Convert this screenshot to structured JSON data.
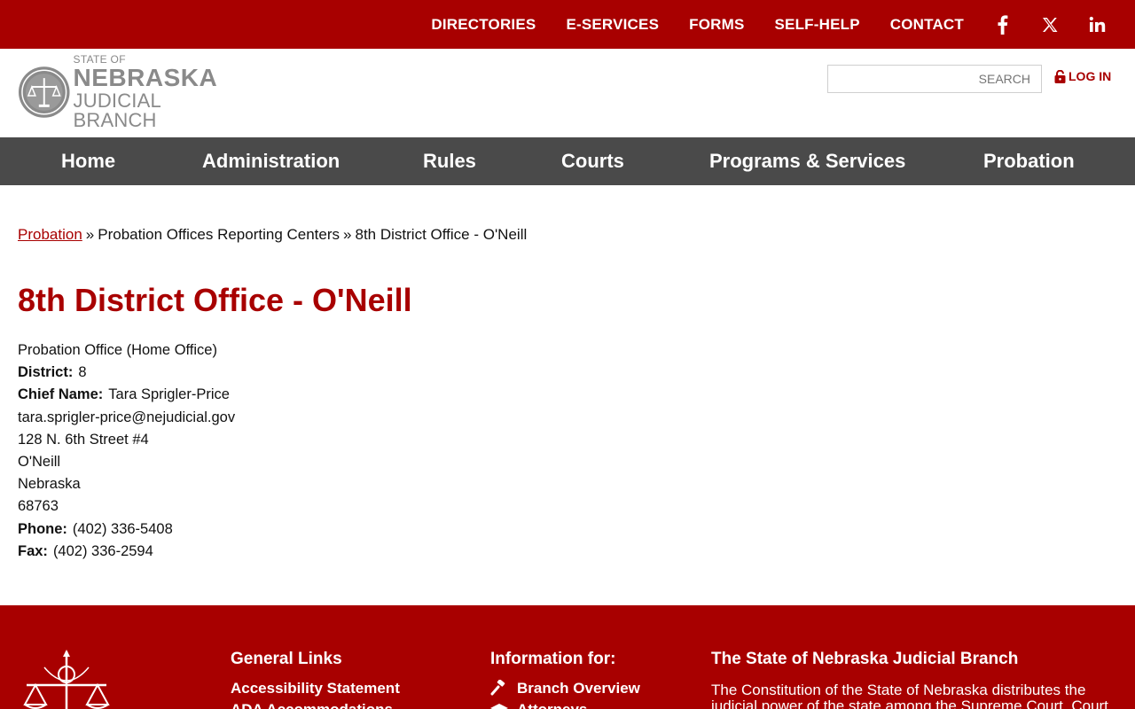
{
  "top_nav": {
    "links": [
      "DIRECTORIES",
      "E-SERVICES",
      "FORMS",
      "SELF-HELP",
      "CONTACT"
    ],
    "social_icons": [
      "facebook-icon",
      "x-icon",
      "linkedin-icon"
    ]
  },
  "header": {
    "logo": {
      "line1": "STATE OF",
      "line2": "NEBRASKA",
      "line3": "JUDICIAL BRANCH"
    },
    "search_placeholder": "SEARCH",
    "login_label": "LOG IN"
  },
  "main_nav": [
    "Home",
    "Administration",
    "Rules",
    "Courts",
    "Programs & Services",
    "Probation"
  ],
  "breadcrumb": {
    "link": "Probation",
    "separator": "»",
    "middle": "Probation Offices Reporting Centers",
    "current": "8th District Office - O'Neill"
  },
  "page_title": "8th District Office - O'Neill",
  "office": {
    "type": "Probation Office (Home Office)",
    "district_label": "District:",
    "district": "8",
    "chief_label": "Chief Name:",
    "chief": "Tara Sprigler-Price",
    "email": "tara.sprigler-price@nejudicial.gov",
    "street": "128 N. 6th Street #4",
    "city": "O'Neill",
    "state": "Nebraska",
    "zip": "68763",
    "phone_label": "Phone:",
    "phone": "(402) 336-5408",
    "fax_label": "Fax:",
    "fax": "(402) 336-2594"
  },
  "footer": {
    "general_links_heading": "General Links",
    "general_links": [
      "Accessibility Statement",
      "ADA Accommodations"
    ],
    "info_heading": "Information for:",
    "info_links": [
      "Branch Overview",
      "Attorneys"
    ],
    "about_heading": "The State of Nebraska Judicial Branch",
    "about_text": "The Constitution of the State of Nebraska distributes the judicial power of the state among the Supreme Court, Court"
  },
  "colors": {
    "brand_red": "#a80000",
    "nav_gray": "#4a4a4a"
  }
}
